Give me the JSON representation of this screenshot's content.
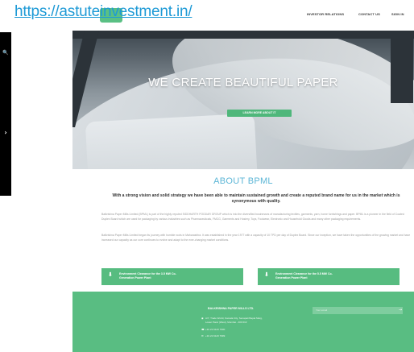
{
  "watermark": {
    "url": "https://astuteinvestment.in/"
  },
  "sidebar": {
    "search_icon": "search-icon",
    "next_icon": "chevron-right-icon"
  },
  "nav": {
    "items": [
      "INVESTOR RELATIONS",
      "CONTACT US",
      "SIGN IN"
    ]
  },
  "hero": {
    "title": "WE CREATE BEAUTIFUL PAPER",
    "button_label": "LEARN MORE ABOUT IT"
  },
  "about": {
    "title": "ABOUT BPML",
    "subtitle": "With a strong vision and solid strategy we have been able to maintain sustained growth and create a reputed brand name for us in the market which is synonymous with quality.",
    "para1": "Balkrishna Paper Mills Limited (BPML) is part of the highly reputed SIDDHARTH PODDAR GROUP which is into the diversified businesses of manufacturing textiles, garments, yarn, home furnishings and paper. BPML is a pioneer in the field of Coated Duplex Board which are used for packaging by various industries such as Pharmaceuticals, FMCG, Garments and Hosiery, Toys, Footwear, Electronic and Household Goods and many other packaging requirements.",
    "para2": "Balkrishna Paper Mills Limited began its journey with humble roots in Maharashtra. It was established in the year 1977 with a capacity of 10 TPD per day of Duplex Board. Since our inception, we have taken the opportunities of the growing market and have increased our capacity as our core continues to evolve and adapt to the ever-changing market conditions.",
    "downloads": [
      "Environment Clearance for the 3.5 MW Co-Generation Power Plant",
      "Environment Clearance for the 5.5 MW Co-Generation Power Plant"
    ]
  },
  "footer": {
    "company": "BALKRISHNA PAPER MILLS LTD.",
    "address1": "A/7, Trade World, Kamala City, Senapati Bapat Marg,",
    "address2": "Lower Parel (West), Mumbai - 400 013",
    "phone1": "+91 22 6120 7900",
    "phone2": "+91 22 6120 7999",
    "newsletter_placeholder": "Your email"
  },
  "colors": {
    "accent_green": "#59bd82",
    "about_title_blue": "#5cb6d6",
    "watermark_blue": "#1e9ad6",
    "side_panel": "#000000"
  }
}
